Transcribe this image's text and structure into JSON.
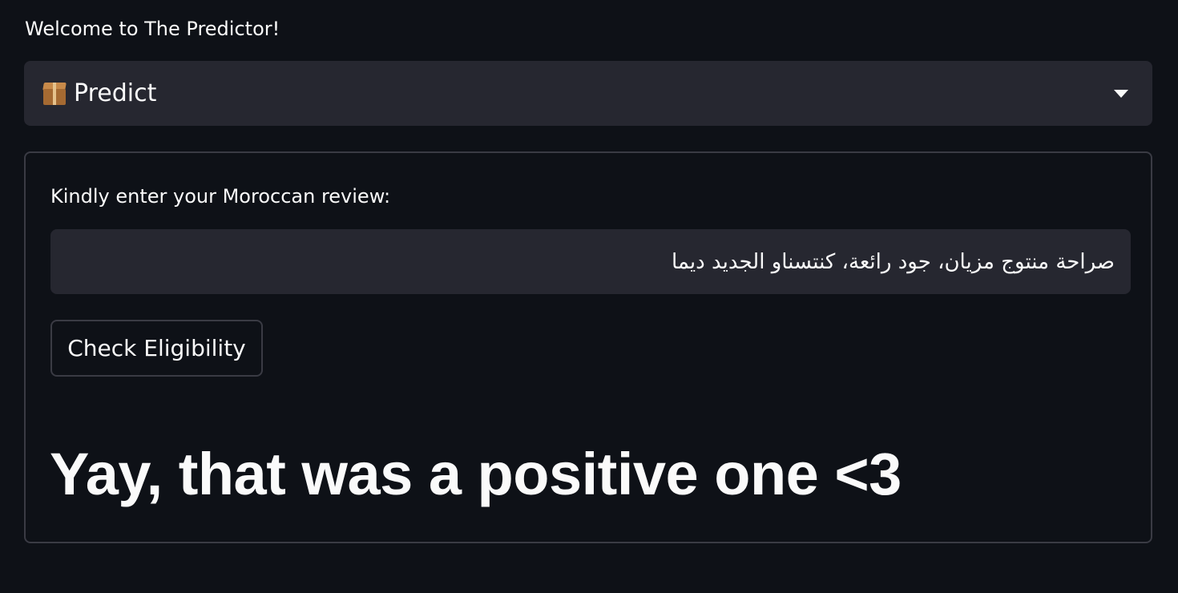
{
  "welcome": {
    "text": "Welcome to The Predictor!"
  },
  "mode_select": {
    "icon": "package-icon",
    "value": "Predict"
  },
  "form": {
    "label": "Kindly enter your Moroccan review:",
    "review_input_value": "صراحة منتوج مزيان، جود رائعة، كنتسناو الجديد ديما",
    "button_label": "Check Eligibility",
    "result_text": "Yay, that was a positive one <3"
  },
  "colors": {
    "background": "#0e1117",
    "surface": "#262730",
    "border": "#3a3b44",
    "text": "#fafafa"
  }
}
